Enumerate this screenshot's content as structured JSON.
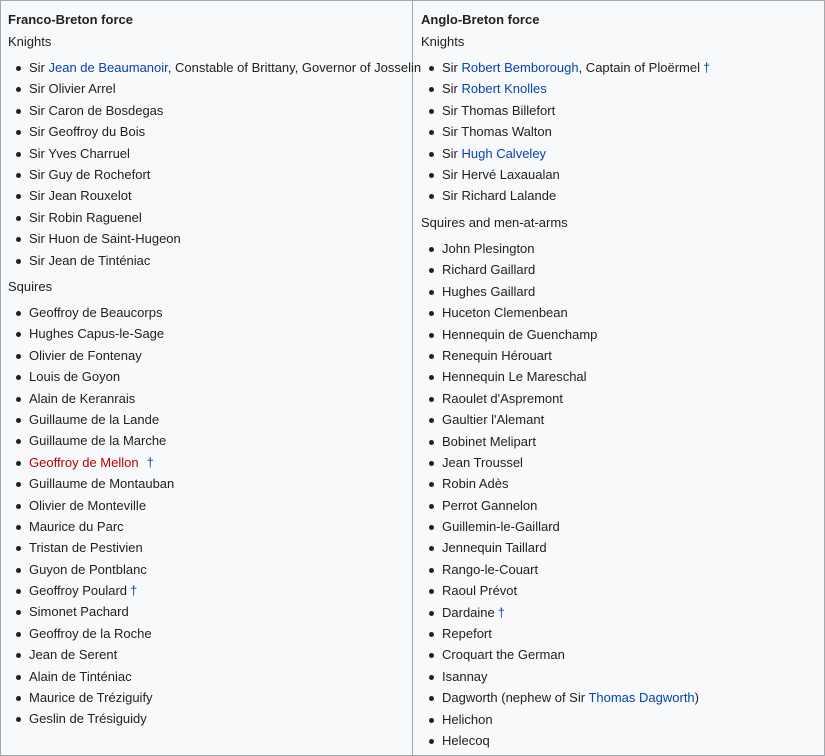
{
  "left": {
    "heading": "Franco-Breton force",
    "knights_label": "Knights",
    "knights": [
      {
        "prefix": "Sir ",
        "link": "Jean de Beaumanoir",
        "suffix": ", Constable of Brittany, Governor of Josselin"
      },
      {
        "prefix": "Sir Olivier Arrel"
      },
      {
        "prefix": "Sir Caron de Bosdegas"
      },
      {
        "prefix": "Sir Geoffroy du Bois"
      },
      {
        "prefix": "Sir Yves Charruel"
      },
      {
        "prefix": "Sir Guy de Rochefort"
      },
      {
        "prefix": "Sir Jean Rouxelot"
      },
      {
        "prefix": "Sir Robin Raguenel"
      },
      {
        "prefix": "Sir Huon de Saint-Hugeon"
      },
      {
        "prefix": "Sir Jean de Tinténiac"
      }
    ],
    "squires_label": "Squires",
    "squires": [
      {
        "prefix": "Geoffroy de Beaucorps"
      },
      {
        "prefix": "Hughes Capus-le-Sage"
      },
      {
        "prefix": "Olivier de Fontenay"
      },
      {
        "prefix": "Louis de Goyon"
      },
      {
        "prefix": "Alain de Keranrais"
      },
      {
        "prefix": "Guillaume de la Lande"
      },
      {
        "prefix": "Guillaume de la Marche"
      },
      {
        "redlink": "Geoffroy de Mellon",
        "dagger": "†"
      },
      {
        "prefix": "Guillaume de Montauban"
      },
      {
        "prefix": "Olivier de Monteville"
      },
      {
        "prefix": "Maurice du Parc"
      },
      {
        "prefix": "Tristan de Pestivien"
      },
      {
        "prefix": "Guyon de Pontblanc"
      },
      {
        "prefix": "Geoffroy Poulard",
        "dagger": "†"
      },
      {
        "prefix": "Simonet Pachard"
      },
      {
        "prefix": "Geoffroy de la Roche"
      },
      {
        "prefix": "Jean de Serent"
      },
      {
        "prefix": "Alain de Tinténiac"
      },
      {
        "prefix": "Maurice de Tréziguify"
      },
      {
        "prefix": "Geslin de Trésiguidy"
      }
    ]
  },
  "right": {
    "heading": "Anglo-Breton force",
    "knights_label": "Knights",
    "knights": [
      {
        "prefix": "Sir ",
        "link": "Robert Bemborough",
        "suffix": ", Captain of Ploërmel",
        "dagger": "†"
      },
      {
        "prefix": "Sir ",
        "link": "Robert Knolles"
      },
      {
        "prefix": "Sir Thomas Billefort"
      },
      {
        "prefix": "Sir Thomas Walton"
      },
      {
        "prefix": "Sir ",
        "link": "Hugh Calveley"
      },
      {
        "prefix": "Sir Hervé Laxaualan"
      },
      {
        "prefix": "Sir Richard Lalande"
      }
    ],
    "squires_label": "Squires and men-at-arms",
    "squires": [
      {
        "prefix": "John Plesington"
      },
      {
        "prefix": "Richard Gaillard"
      },
      {
        "prefix": "Hughes Gaillard"
      },
      {
        "prefix": "Huceton Clemenbean"
      },
      {
        "prefix": "Hennequin de Guenchamp"
      },
      {
        "prefix": "Renequin Hérouart"
      },
      {
        "prefix": "Hennequin Le Mareschal"
      },
      {
        "prefix": "Raoulet d'Aspremont"
      },
      {
        "prefix": "Gaultier l'Alemant"
      },
      {
        "prefix": "Bobinet Melipart"
      },
      {
        "prefix": "Jean Troussel"
      },
      {
        "prefix": "Robin Adès"
      },
      {
        "prefix": "Perrot Gannelon"
      },
      {
        "prefix": "Guillemin-le-Gaillard"
      },
      {
        "prefix": "Jennequin Taillard"
      },
      {
        "prefix": "Rango-le-Couart"
      },
      {
        "prefix": "Raoul Prévot"
      },
      {
        "prefix": "Dardaine",
        "dagger": "†"
      },
      {
        "prefix": "Repefort"
      },
      {
        "prefix": "Croquart the German"
      },
      {
        "prefix": "Isannay"
      },
      {
        "prefix": "Dagworth (nephew of Sir ",
        "link": "Thomas Dagworth",
        "suffix": ")"
      },
      {
        "prefix": "Helichon"
      },
      {
        "prefix": "Helecoq"
      }
    ]
  }
}
